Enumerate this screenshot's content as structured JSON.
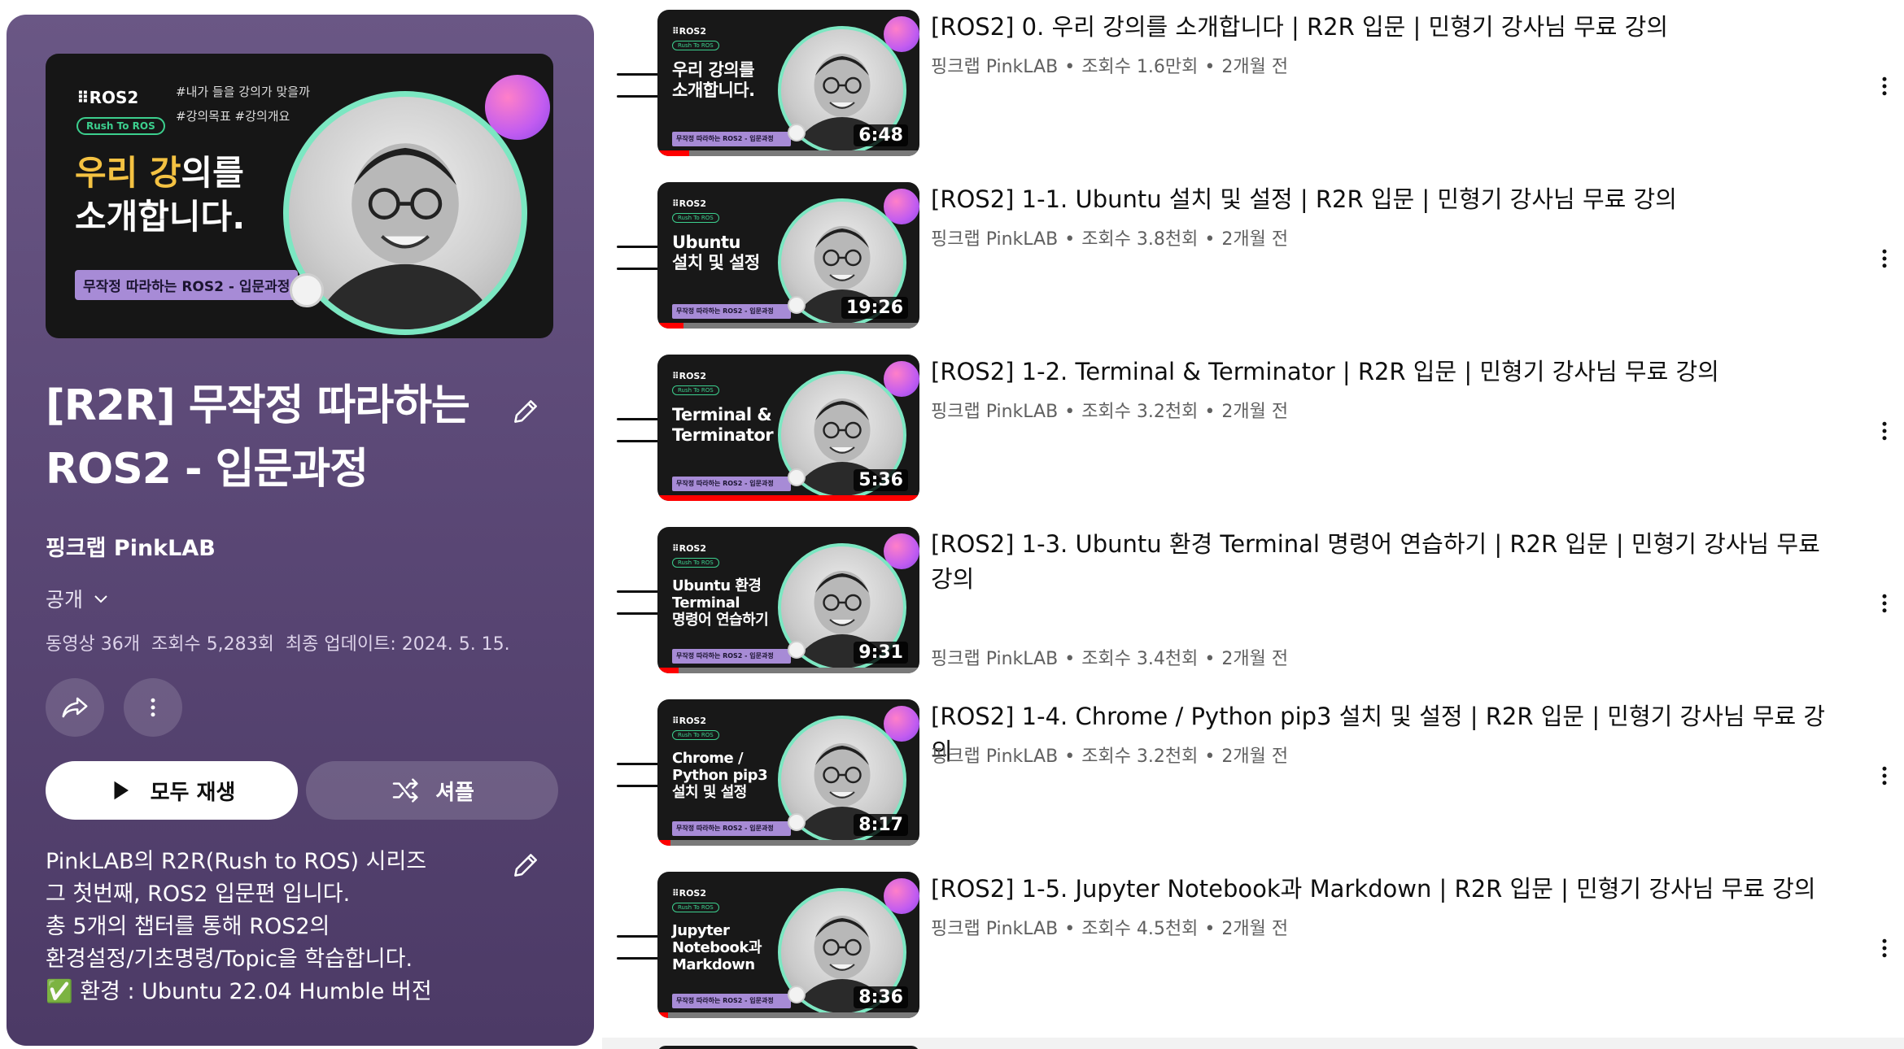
{
  "playlist": {
    "hero": {
      "brand": "⠿ROS2",
      "pill": "Rush To ROS",
      "tags": [
        "#내가 들을 강의가 맞을까",
        "#강의목표 #강의개요"
      ],
      "big_line1_accent": "우리 강",
      "big_line1_rest": "의를",
      "big_line2": "소개합니다.",
      "bar": "무작정 따라하는 ROS2 - 입문과정"
    },
    "title": "[R2R] 무작정 따라하는 ROS2 - 입문과정",
    "channel": "핑크랩 PinkLAB",
    "privacy": "공개",
    "stats": {
      "videos": "동영상 36개",
      "views": "조회수 5,283회",
      "updated": "최종 업데이트: 2024. 5. 15."
    },
    "play_all_label": "모두 재생",
    "shuffle_label": "셔플",
    "description": [
      "PinkLAB의 R2R(Rush to ROS) 시리즈",
      "그 첫번째, ROS2 입문편 입니다.",
      "총 5개의 챕터를 통해 ROS2의",
      "환경설정/기초명령/Topic을 학습합니다.",
      "✅ 환경 : Ubuntu 22.04 Humble 버전"
    ]
  },
  "videos": [
    {
      "title": "[ROS2] 0. 우리 강의를 소개합니다 | R2R 입문 | 민형기 강사님 무료 강의",
      "channel": "핑크랩 PinkLAB",
      "views": "조회수 1.6만회",
      "age": "2개월 전",
      "duration": "6:48",
      "thumb_lines": [
        "우리 강의를",
        "소개합니다."
      ],
      "progress": 0.12
    },
    {
      "title": "[ROS2] 1-1. Ubuntu 설치 및 설정 | R2R 입문 | 민형기 강사님 무료 강의",
      "channel": "핑크랩 PinkLAB",
      "views": "조회수 3.8천회",
      "age": "2개월 전",
      "duration": "19:26",
      "thumb_lines": [
        "Ubuntu",
        "설치 및 설정"
      ],
      "progress": 0.1
    },
    {
      "title": "[ROS2] 1-2. Terminal & Terminator | R2R 입문 | 민형기 강사님 무료 강의",
      "channel": "핑크랩 PinkLAB",
      "views": "조회수 3.2천회",
      "age": "2개월 전",
      "duration": "5:36",
      "thumb_lines": [
        "Terminal &",
        "Terminator"
      ],
      "progress": 1.0
    },
    {
      "title": "[ROS2] 1-3. Ubuntu 환경 Terminal 명령어 연습하기 | R2R 입문 | 민형기 강사님 무료 강의",
      "channel": "핑크랩 PinkLAB",
      "views": "조회수 3.4천회",
      "age": "2개월 전",
      "duration": "9:31",
      "thumb_lines": [
        "Ubuntu 환경",
        "Terminal",
        "명령어 연습하기"
      ],
      "progress": 0.08
    },
    {
      "title": "[ROS2] 1-4. Chrome / Python pip3 설치 및 설정 | R2R 입문 | 민형기 강사님 무료 강의",
      "channel": "핑크랩 PinkLAB",
      "views": "조회수 3.2천회",
      "age": "2개월 전",
      "duration": "8:17",
      "thumb_lines": [
        "Chrome /",
        "Python pip3",
        "설치 및 설정"
      ],
      "progress": 0.05
    },
    {
      "title": "[ROS2] 1-5. Jupyter Notebook과 Markdown | R2R 입문 | 민형기 강사님 무료 강의",
      "channel": "핑크랩 PinkLAB",
      "views": "조회수 4.5천회",
      "age": "2개월 전",
      "duration": "8:36",
      "thumb_lines": [
        "Jupyter",
        "Notebook과",
        "Markdown"
      ],
      "progress": 0.04
    }
  ],
  "thumb_common": {
    "brand": "⠿ROS2",
    "pill": "Rush To ROS",
    "bar": "무작정 따라하는 ROS2 - 입문과정"
  },
  "colors": {
    "panel_top": "#6a5785",
    "panel_bottom": "#4c3a66",
    "accent_green": "#7ce7c2",
    "thumb_bar": "#a78bd6",
    "progress_red": "#ff0000"
  },
  "icons": {
    "edit": "pencil-icon",
    "share": "share-icon",
    "more": "more-vertical-icon",
    "play": "play-icon",
    "shuffle": "shuffle-icon",
    "privacy_chevron": "chevron-down-icon",
    "drag": "drag-handle-icon"
  }
}
